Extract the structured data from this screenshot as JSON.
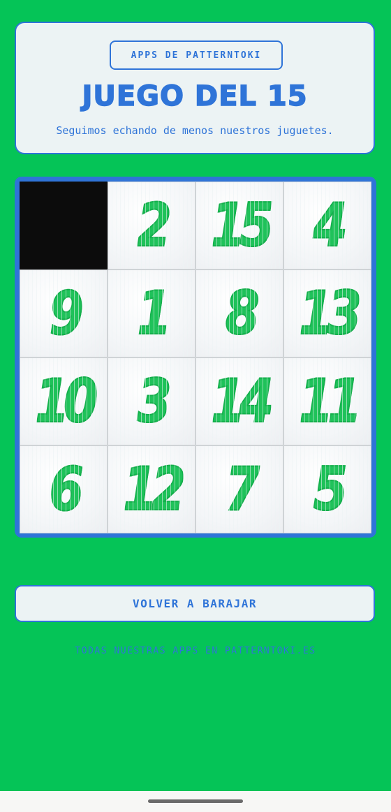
{
  "header": {
    "badge_label": "APPS DE PATTERNTOKI",
    "title": "JUEGO DEL 15",
    "subtitle": "Seguimos echando de menos nuestros juguetes."
  },
  "board": {
    "tiles": [
      {
        "number": null,
        "empty": true
      },
      {
        "number": "2"
      },
      {
        "number": "15"
      },
      {
        "number": "4"
      },
      {
        "number": "9"
      },
      {
        "number": "1"
      },
      {
        "number": "8"
      },
      {
        "number": "13"
      },
      {
        "number": "10"
      },
      {
        "number": "3"
      },
      {
        "number": "14"
      },
      {
        "number": "11"
      },
      {
        "number": "6"
      },
      {
        "number": "12"
      },
      {
        "number": "7"
      },
      {
        "number": "5"
      }
    ]
  },
  "actions": {
    "shuffle_label": "VOLVER A BARAJAR"
  },
  "footer": {
    "link_label": "TODAS NUESTRAS APPS EN PATTERNTOKI.ES"
  },
  "colors": {
    "background": "#05c457",
    "accent": "#2f74d8",
    "card": "#ecf3f4",
    "tile_digit": "#1fc25a",
    "empty_tile": "#0c0c0c"
  }
}
